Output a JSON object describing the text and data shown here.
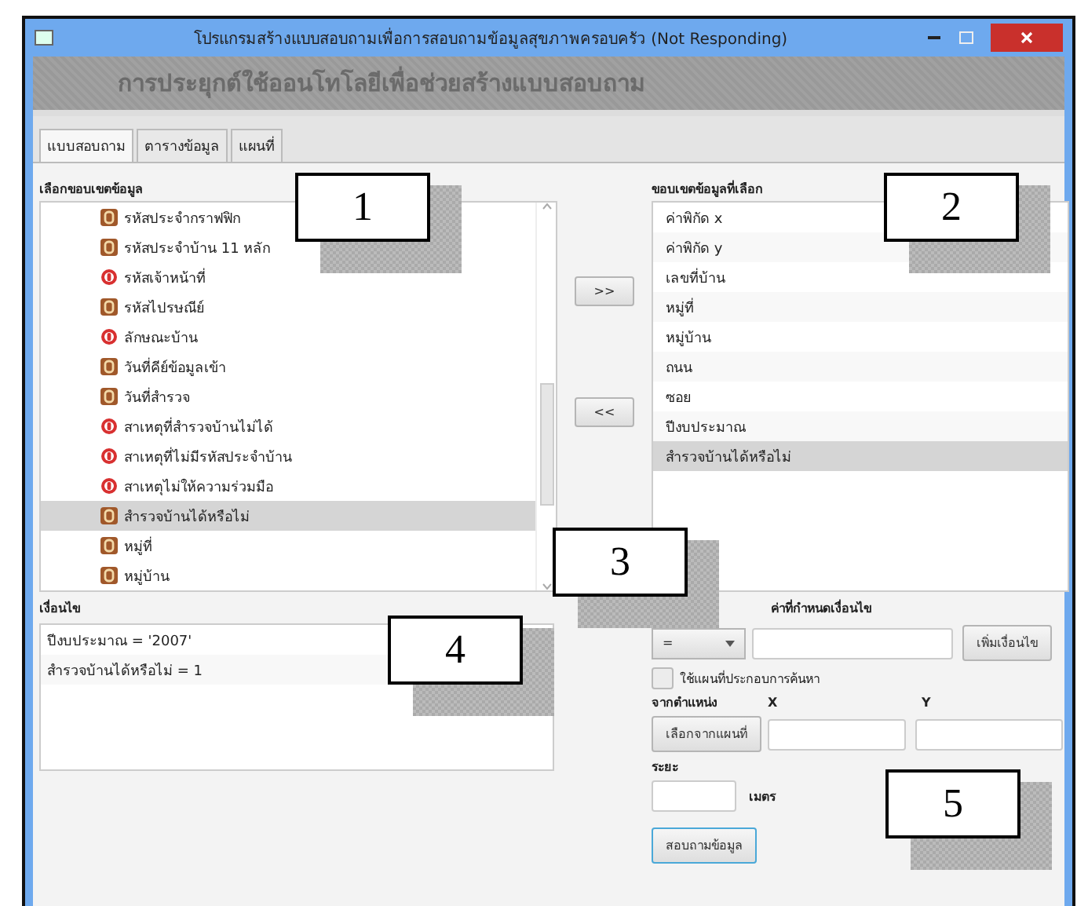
{
  "window": {
    "title": "โปรแกรมสร้างแบบสอบถามเพื่อการสอบถามข้อมูลสุขภาพครอบครัว (Not Responding)"
  },
  "banner": {
    "title": "การประยุกต์ใช้ออนโทโลยีเพื่อช่วยสร้างแบบสอบถาม"
  },
  "tabs": [
    {
      "label": "แบบสอบถาม",
      "selected": true
    },
    {
      "label": "ตารางข้อมูล",
      "selected": false
    },
    {
      "label": "แผนที่",
      "selected": false
    }
  ],
  "field_list": {
    "label": "เลือกขอบเขตข้อมูล",
    "items": [
      {
        "label": "รหัสประจำกราฟฟิก",
        "kind": "letter",
        "selected": false
      },
      {
        "label": "รหัสประจำบ้าน 11 หลัก",
        "kind": "letter",
        "selected": false
      },
      {
        "label": "รหัสเจ้าหน้าที่",
        "kind": "marker",
        "selected": false
      },
      {
        "label": "รหัสไปรษณีย์",
        "kind": "letter",
        "selected": false
      },
      {
        "label": "ลักษณะบ้าน",
        "kind": "marker",
        "selected": false
      },
      {
        "label": "วันที่คีย์ข้อมูลเข้า",
        "kind": "letter",
        "selected": false
      },
      {
        "label": "วันที่สำรวจ",
        "kind": "letter",
        "selected": false
      },
      {
        "label": "สาเหตุที่สำรวจบ้านไม่ได้",
        "kind": "marker",
        "selected": false
      },
      {
        "label": "สาเหตุที่ไม่มีรหัสประจำบ้าน",
        "kind": "marker",
        "selected": false
      },
      {
        "label": "สาเหตุไม่ให้ความร่วมมือ",
        "kind": "marker",
        "selected": false
      },
      {
        "label": "สำรวจบ้านได้หรือไม่",
        "kind": "letter",
        "selected": true
      },
      {
        "label": "หมู่ที่",
        "kind": "letter",
        "selected": false
      },
      {
        "label": "หมู่บ้าน",
        "kind": "letter",
        "selected": false
      }
    ]
  },
  "move_buttons": [
    ">>",
    "<<"
  ],
  "selected_list": {
    "label": "ขอบเขตข้อมูลที่เลือก",
    "items": [
      {
        "label": "ค่าพิกัด x",
        "selected": false
      },
      {
        "label": "ค่าพิกัด y",
        "selected": false
      },
      {
        "label": "เลขที่บ้าน",
        "selected": false
      },
      {
        "label": "หมู่ที่",
        "selected": false
      },
      {
        "label": "หมู่บ้าน",
        "selected": false
      },
      {
        "label": "ถนน",
        "selected": false
      },
      {
        "label": "ซอย",
        "selected": false
      },
      {
        "label": "ปีงบประมาณ",
        "selected": false
      },
      {
        "label": "สำรวจบ้านได้หรือไม่",
        "selected": true
      }
    ]
  },
  "conditions": {
    "label": "เงื่อนไข",
    "items": [
      "ปีงบประมาณ = '2007'",
      "สำรวจบ้านได้หรือไม่ = 1"
    ]
  },
  "condition_form": {
    "value_label": "ค่าที่กำหนดเงื่อนไข",
    "operator": "=",
    "add_button": "เพิ่มเงื่อนไข",
    "use_map": {
      "label": "ใช้แผนที่ประกอบการค้นหา",
      "checked": false
    },
    "position_label": "จากตำแหน่ง",
    "x_label": "X",
    "y_label": "Y",
    "pick_button": "เลือกจากแผนที่",
    "distance_label": "ระยะ",
    "unit": "เมตร",
    "query_button": "สอบถามข้อมูล"
  },
  "callouts": [
    "1",
    "2",
    "3",
    "4",
    "5"
  ]
}
